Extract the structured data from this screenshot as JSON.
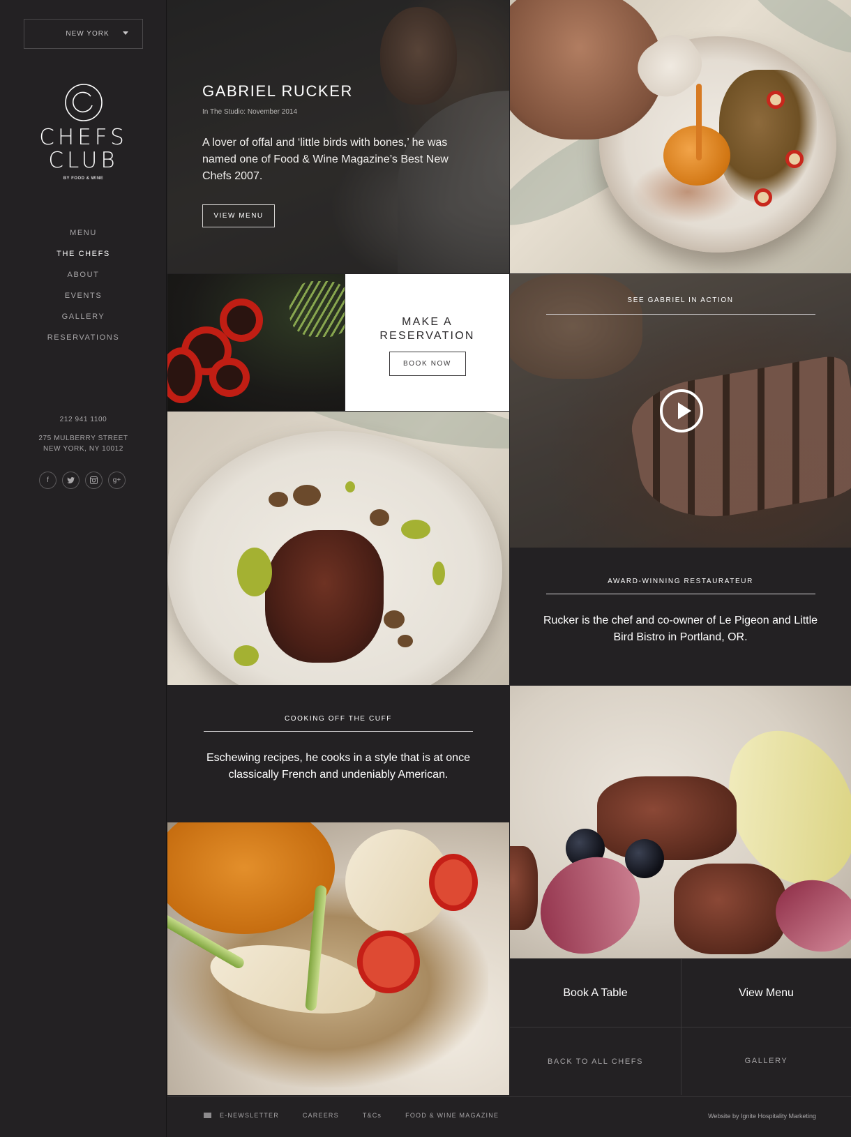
{
  "sidebar": {
    "city": "NEW YORK",
    "logo": {
      "line1": "CHEFS",
      "line2": "CLUB",
      "byline": "BY FOOD & WINE"
    },
    "nav": [
      "MENU",
      "THE CHEFS",
      "ABOUT",
      "EVENTS",
      "GALLERY",
      "RESERVATIONS"
    ],
    "active_nav": "THE CHEFS",
    "phone": "212 941 1100",
    "address_line1": "275 MULBERRY STREET",
    "address_line2": "NEW YORK, NY 10012",
    "social": [
      "facebook-icon",
      "twitter-icon",
      "instagram-icon",
      "google-plus-icon"
    ]
  },
  "hero": {
    "name": "GABRIEL RUCKER",
    "subtitle": "In The Studio: November 2014",
    "description": "A lover of offal and ‘little birds with bones,’ he was named one of Food & Wine Magazine’s Best New Chefs 2007.",
    "button": "VIEW MENU"
  },
  "reservation": {
    "title_line1": "MAKE A",
    "title_line2": "RESERVATION",
    "button": "BOOK NOW"
  },
  "video": {
    "kicker": "SEE GABRIEL IN ACTION"
  },
  "award": {
    "kicker": "AWARD-WINNING RESTAURATEUR",
    "text": "Rucker is the chef and co-owner of Le Pigeon and Little Bird Bistro in Portland, OR."
  },
  "cuff": {
    "kicker": "COOKING OFF THE CUFF",
    "text": "Eschewing recipes, he cooks in a style that is at once classically French and undeniably American."
  },
  "ctas": {
    "book_table": "Book A Table",
    "view_menu": "View Menu",
    "back": "BACK TO ALL CHEFS",
    "gallery": "GALLERY"
  },
  "footer": {
    "links": [
      "E-NEWSLETTER",
      "CAREERS",
      "T&Cs",
      "FOOD & WINE MAGAZINE"
    ],
    "credit": "Website by Ignite Hospitality Marketing"
  },
  "colors": {
    "background": "#232123",
    "text": "#ffffff",
    "muted": "#a9a7a9",
    "panel_white": "#ffffff"
  }
}
